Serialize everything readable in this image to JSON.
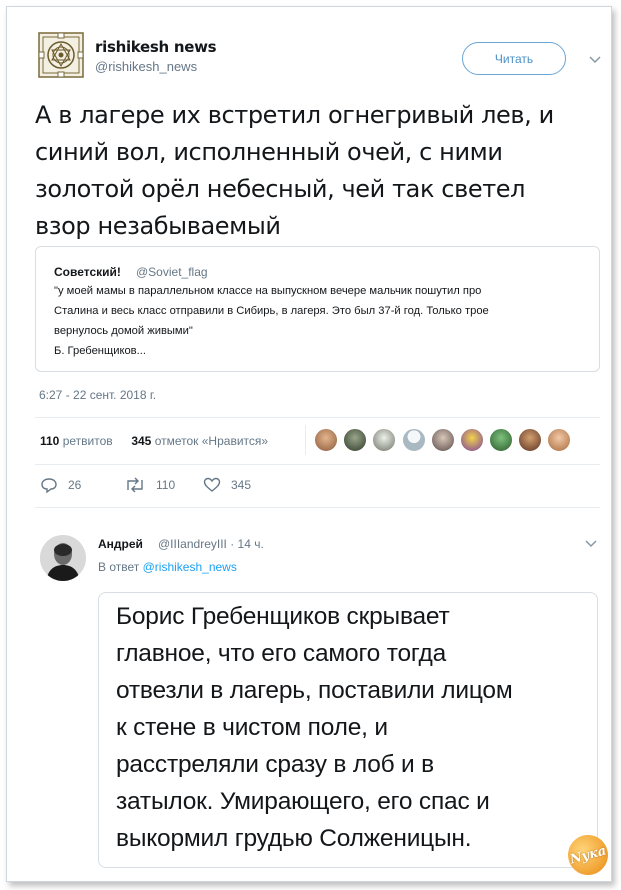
{
  "tweet": {
    "author_name": "rishikesh news",
    "author_handle": "@rishikesh_news",
    "follow_label": "Читать",
    "text_lines": [
      "А в лагере их встретил огнегривый лев, и",
      "синий вол, исполненный очей, с ними",
      "золотой орёл небесный, чей так светел",
      "взор незабываемый"
    ],
    "quote": {
      "name": "Советский!",
      "handle": "@Soviet_flag",
      "lines": [
        "\"у моей мамы в параллельном классе на выпускном вечере мальчик пошутил про",
        "Сталина и весь класс отправили в Сибирь, в лагеря. Это был 37-й год. Только трое",
        "вернулось домой живыми\"",
        "Б. Гребенщиков..."
      ]
    },
    "timestamp": "6:27 - 22 сент. 2018 г.",
    "retweets_count": "110",
    "retweets_label": "ретвитов",
    "likes_count": "345",
    "likes_label": "отметок «Нравится»",
    "actions": {
      "reply_count": "26",
      "retweet_count": "110",
      "like_count": "345"
    }
  },
  "reply": {
    "name": "Андрей",
    "handle_time": "@IIIandreyIII · 14 ч.",
    "reply_to_prefix": "В ответ",
    "reply_to_handle": "@rishikesh_news",
    "text_lines": [
      "Борис Гребенщиков скрывает",
      "главное, что его самого тогда",
      "отвезли в лагерь, поставили лицом",
      "к стене в чистом поле, и",
      "расстреляли сразу в лоб и в",
      "затылок. Умирающего, его спас и",
      "выкормил грудью Солженицын."
    ]
  },
  "watermark": "Nука",
  "icons": [
    "mandala-logo-icon",
    "chevron-down-icon",
    "reply-icon",
    "retweet-icon",
    "heart-icon"
  ],
  "colors": {
    "link": "#1da1f2",
    "follow_border": "#6aa5d6",
    "muted": "#657786"
  }
}
